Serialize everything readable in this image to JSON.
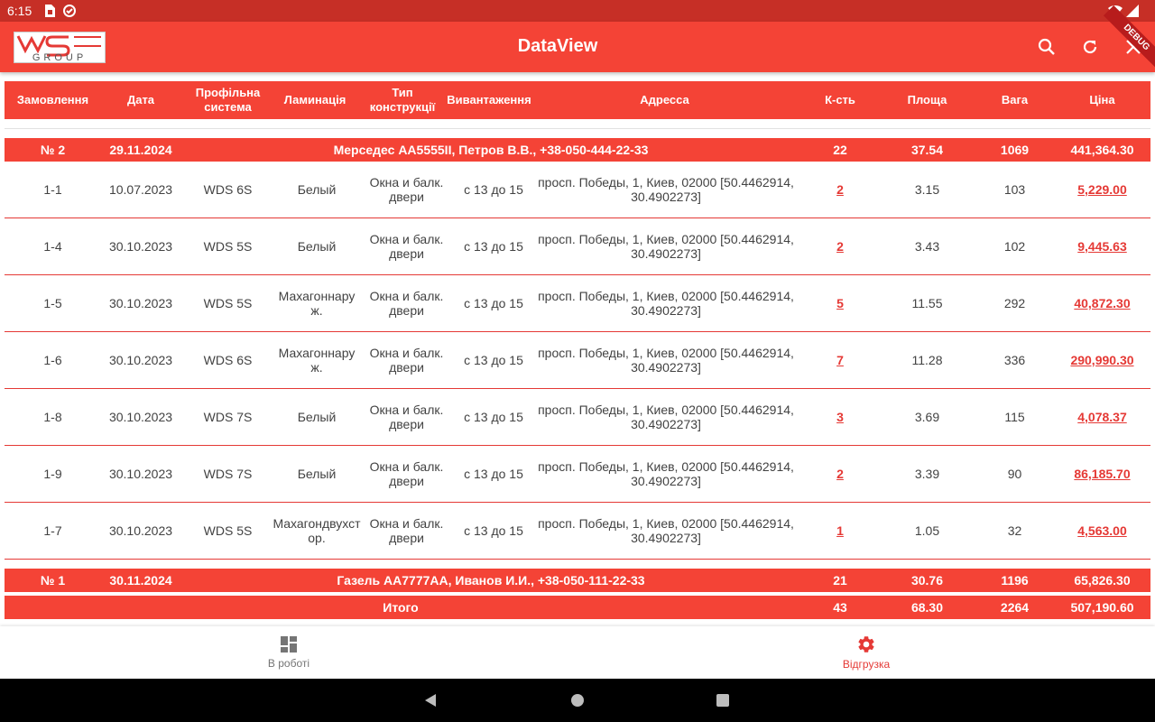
{
  "status_bar": {
    "time": "6:15"
  },
  "app_bar": {
    "title": "DataView",
    "debug_label": "DEBUG"
  },
  "logo": {
    "text_top": "WS",
    "text_bottom": "GROUP"
  },
  "table": {
    "headers": [
      "Замовлення",
      "Дата",
      "Профільна система",
      "Ламинація",
      "Тип конструкції",
      "Вивантаження",
      "Адресса",
      "К-сть",
      "Площа",
      "Вага",
      "Ціна"
    ],
    "groups": [
      {
        "order": "№ 2",
        "date": "29.11.2024",
        "info": "Мерседес АА5555II, Петров В.В., +38-050-444-22-33",
        "qty": "22",
        "area": "37.54",
        "weight": "1069",
        "price": "441,364.30",
        "rows": [
          {
            "order": "1-1",
            "date": "10.07.2023",
            "system": "WDS 6S",
            "lamination": "Белый",
            "type": "Окна и балк. двери",
            "unload": "с 13 до 15",
            "address": "просп. Победы, 1, Киев, 02000 [50.4462914, 30.4902273]",
            "qty": "2",
            "area": "3.15",
            "weight": "103",
            "price": "5,229.00"
          },
          {
            "order": "1-4",
            "date": "30.10.2023",
            "system": "WDS 5S",
            "lamination": "Белый",
            "type": "Окна и балк. двери",
            "unload": "с 13 до 15",
            "address": "просп. Победы, 1, Киев, 02000 [50.4462914, 30.4902273]",
            "qty": "2",
            "area": "3.43",
            "weight": "102",
            "price": "9,445.63"
          },
          {
            "order": "1-5",
            "date": "30.10.2023",
            "system": "WDS 5S",
            "lamination": "Махагоннаруж.",
            "type": "Окна и балк. двери",
            "unload": "с 13 до 15",
            "address": "просп. Победы, 1, Киев, 02000 [50.4462914, 30.4902273]",
            "qty": "5",
            "area": "11.55",
            "weight": "292",
            "price": "40,872.30"
          },
          {
            "order": "1-6",
            "date": "30.10.2023",
            "system": "WDS 6S",
            "lamination": "Махагоннаруж.",
            "type": "Окна и балк. двери",
            "unload": "с 13 до 15",
            "address": "просп. Победы, 1, Киев, 02000 [50.4462914, 30.4902273]",
            "qty": "7",
            "area": "11.28",
            "weight": "336",
            "price": "290,990.30"
          },
          {
            "order": "1-8",
            "date": "30.10.2023",
            "system": "WDS 7S",
            "lamination": "Белый",
            "type": "Окна и балк. двери",
            "unload": "с 13 до 15",
            "address": "просп. Победы, 1, Киев, 02000 [50.4462914, 30.4902273]",
            "qty": "3",
            "area": "3.69",
            "weight": "115",
            "price": "4,078.37"
          },
          {
            "order": "1-9",
            "date": "30.10.2023",
            "system": "WDS 7S",
            "lamination": "Белый",
            "type": "Окна и балк. двери",
            "unload": "с 13 до 15",
            "address": "просп. Победы, 1, Киев, 02000 [50.4462914, 30.4902273]",
            "qty": "2",
            "area": "3.39",
            "weight": "90",
            "price": "86,185.70"
          },
          {
            "order": "1-7",
            "date": "30.10.2023",
            "system": "WDS 5S",
            "lamination": "Махагондвухстор.",
            "type": "Окна и балк. двери",
            "unload": "с 13 до 15",
            "address": "просп. Победы, 1, Киев, 02000 [50.4462914, 30.4902273]",
            "qty": "1",
            "area": "1.05",
            "weight": "32",
            "price": "4,563.00"
          }
        ]
      },
      {
        "order": "№ 1",
        "date": "30.11.2024",
        "info": "Газель АА7777АА, Иванов И.И., +38-050-111-22-33",
        "qty": "21",
        "area": "30.76",
        "weight": "1196",
        "price": "65,826.30",
        "rows": []
      }
    ],
    "total": {
      "label": "Итого",
      "qty": "43",
      "area": "68.30",
      "weight": "2264",
      "price": "507,190.60"
    }
  },
  "bottom_nav": {
    "items": [
      {
        "label": "В роботі",
        "icon": "dashboard-icon",
        "active": false
      },
      {
        "label": "Відгрузка",
        "icon": "gear-icon",
        "active": true
      }
    ]
  },
  "colors": {
    "primary": "#f44336",
    "status_bar": "#c62f26",
    "link": "#e53935",
    "inactive": "#757575"
  }
}
